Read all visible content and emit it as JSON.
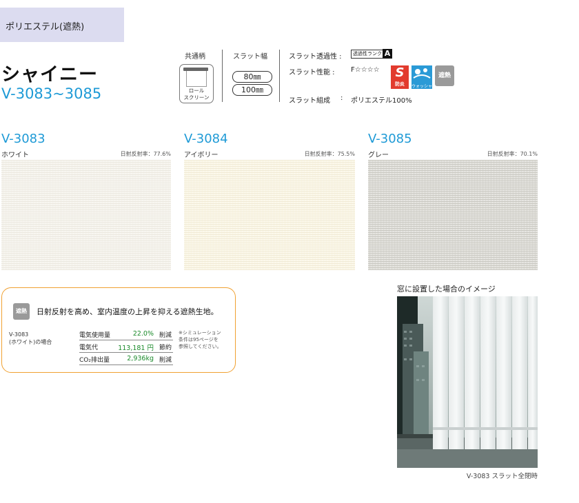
{
  "category_tag": "ポリエステル(遮熱)",
  "product": {
    "name": "シャイニー",
    "code_range": "V-3083~3085"
  },
  "specs": {
    "common_pattern_label": "共通柄",
    "roll_screen_label_1": "ロール",
    "roll_screen_label_2": "スクリーン",
    "slat_width_label": "スラット幅",
    "widths": [
      "80㎜",
      "100㎜"
    ],
    "transmittance_label": "スラット透過性 :",
    "transmittance_rank_text": "透過性ランク",
    "transmittance_rank": "A",
    "performance_label": "スラット性能 :",
    "performance_value": "F☆☆☆☆",
    "performance_icons": [
      "防炎",
      "ウォッシャブル",
      "遮熱"
    ],
    "composition_label": "スラット組成",
    "composition_sep": ":",
    "composition_value": "ポリエステル100%"
  },
  "swatches": [
    {
      "code": "V-3083",
      "name": "ホワイト",
      "reflectance": "日射反射率：77.6%",
      "color": "#f6f4ee",
      "texture": "#ebe8df"
    },
    {
      "code": "V-3084",
      "name": "アイボリー",
      "reflectance": "日射反射率：75.5%",
      "color": "#fbf7e8",
      "texture": "#f0ead5"
    },
    {
      "code": "V-3085",
      "name": "グレー",
      "reflectance": "日射反射率：70.1%",
      "color": "#e0dfda",
      "texture": "#c9c8c1"
    }
  ],
  "callout": {
    "badge": "遮熱",
    "title": "日射反射を高め、室内温度の上昇を抑える遮熱生地。",
    "sample_line1": "V-3083",
    "sample_line2": "(ホワイト)の場合",
    "rows": [
      {
        "label": "電気使用量",
        "value": "22.0%",
        "unit": "削減"
      },
      {
        "label": "電気代",
        "value": "113,181 円",
        "unit": "節約"
      },
      {
        "label": "CO₂排出量",
        "value": "2,936kg",
        "unit": "削減"
      }
    ],
    "note_lines": [
      "※シミュレーション",
      "条件は95ページを",
      "参照してください。"
    ]
  },
  "photo": {
    "title": "窓に設置した場合のイメージ",
    "caption": "V-3083 スラット全閉時"
  }
}
